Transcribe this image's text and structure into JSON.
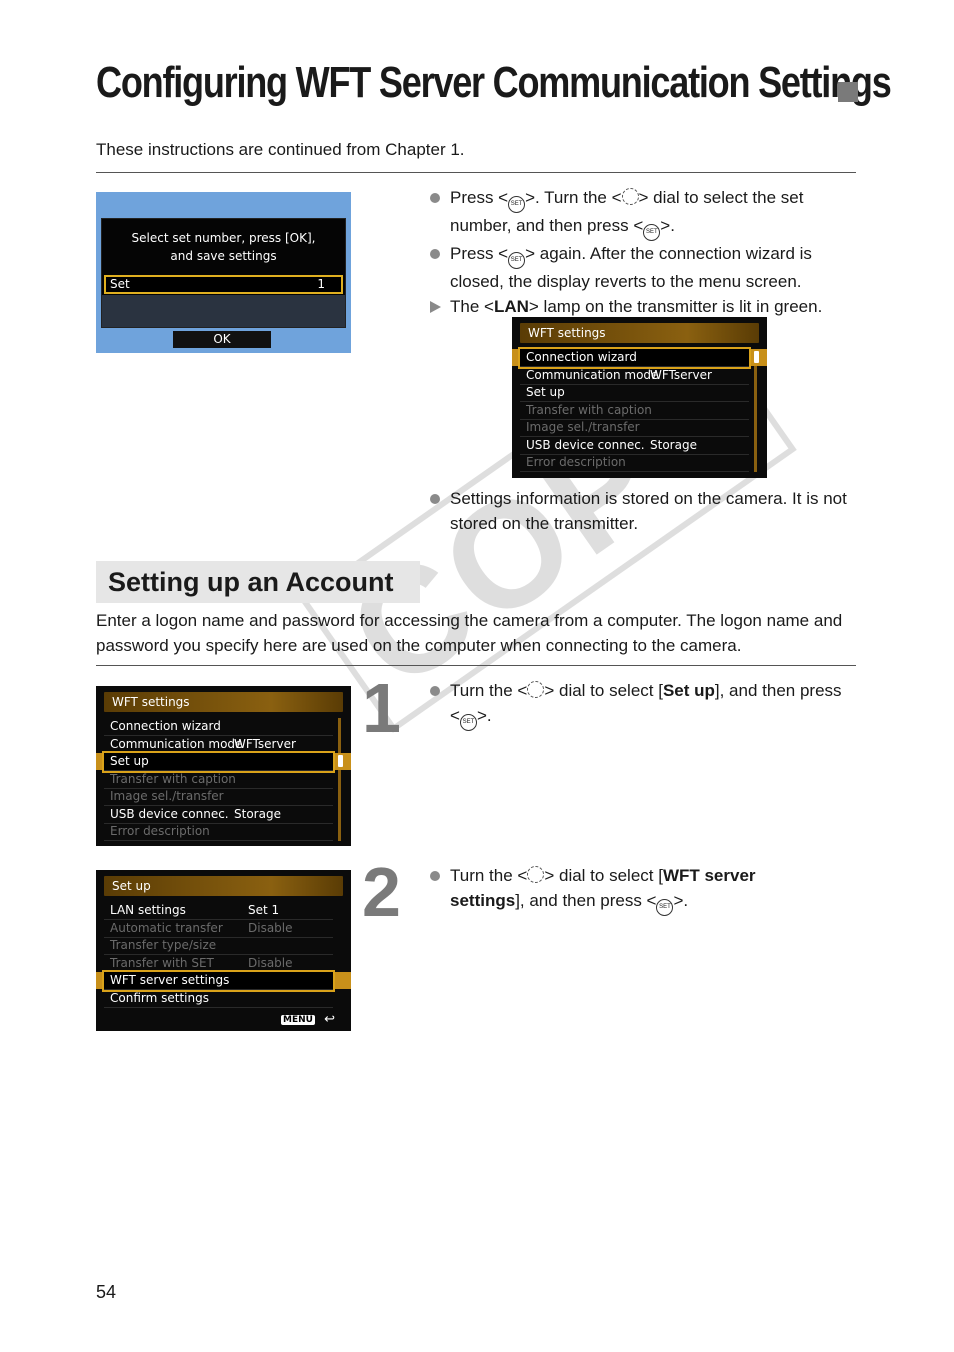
{
  "page": {
    "title": "Configuring WFT Server Communication Settings",
    "intro": "These instructions are continued from Chapter 1.",
    "page_number": "54",
    "watermark": "COPY"
  },
  "dialog_screen": {
    "message_line1": "Select set number, press [OK],",
    "message_line2": "and save settings",
    "set_label": "Set",
    "set_value": "1",
    "ok_label": "OK"
  },
  "instructions_top": [
    {
      "type": "bullet",
      "parts": [
        "Press <",
        "set",
        ">. Turn the <",
        "dial",
        "> dial to select the set number, and then press <",
        "set",
        ">."
      ]
    },
    {
      "type": "bullet",
      "parts": [
        "Press <",
        "set",
        "> again. After the connection wizard is closed, the display reverts to the menu screen."
      ]
    },
    {
      "type": "result",
      "parts": [
        "The <",
        "LAN",
        "> lamp on the transmitter is lit in green."
      ]
    }
  ],
  "wft_menu": {
    "header": "WFT settings",
    "items": [
      {
        "label": "Connection wizard",
        "value": "",
        "enabled": true
      },
      {
        "label": "Communication mode",
        "value": "WFTserver",
        "enabled": true
      },
      {
        "label": "Set up",
        "value": "",
        "enabled": true
      },
      {
        "label": "Transfer with caption",
        "value": "",
        "enabled": false
      },
      {
        "label": "Image sel./transfer",
        "value": "",
        "enabled": false
      },
      {
        "label": "USB device connec.",
        "value": "Storage",
        "enabled": true
      },
      {
        "label": "Error description",
        "value": "",
        "enabled": false
      }
    ]
  },
  "settings_note": "Settings information is stored on the camera. It is not stored on the transmitter.",
  "section": {
    "heading": "Setting up an Account",
    "intro": "Enter a logon name and password for accessing the camera from a computer. The logon name and password you specify here are used on the computer when connecting to the camera."
  },
  "steps": [
    {
      "number": "1",
      "text_pre": "Turn the <",
      "text_mid": "> dial to select [",
      "bold": "Set up",
      "text_post": "], and then press <",
      "text_end": ">."
    },
    {
      "number": "2",
      "text_pre": "Turn the <",
      "text_mid": "> dial to select [",
      "bold": "WFT server settings",
      "text_post": "], and then press <",
      "text_end": ">."
    }
  ],
  "setup_menu": {
    "header": "Set up",
    "items": [
      {
        "label": "LAN settings",
        "value": "Set 1",
        "enabled": true
      },
      {
        "label": "Automatic transfer",
        "value": "Disable",
        "enabled": false
      },
      {
        "label": "Transfer type/size",
        "value": "",
        "enabled": false
      },
      {
        "label": "Transfer with SET",
        "value": "Disable",
        "enabled": false
      },
      {
        "label": "WFT server settings",
        "value": "",
        "enabled": true
      },
      {
        "label": "Confirm settings",
        "value": "",
        "enabled": true
      }
    ],
    "menu_button": "MENU",
    "return_icon": "↩"
  },
  "icons": {
    "set_button": "SET",
    "dial": "quick-control-dial"
  }
}
